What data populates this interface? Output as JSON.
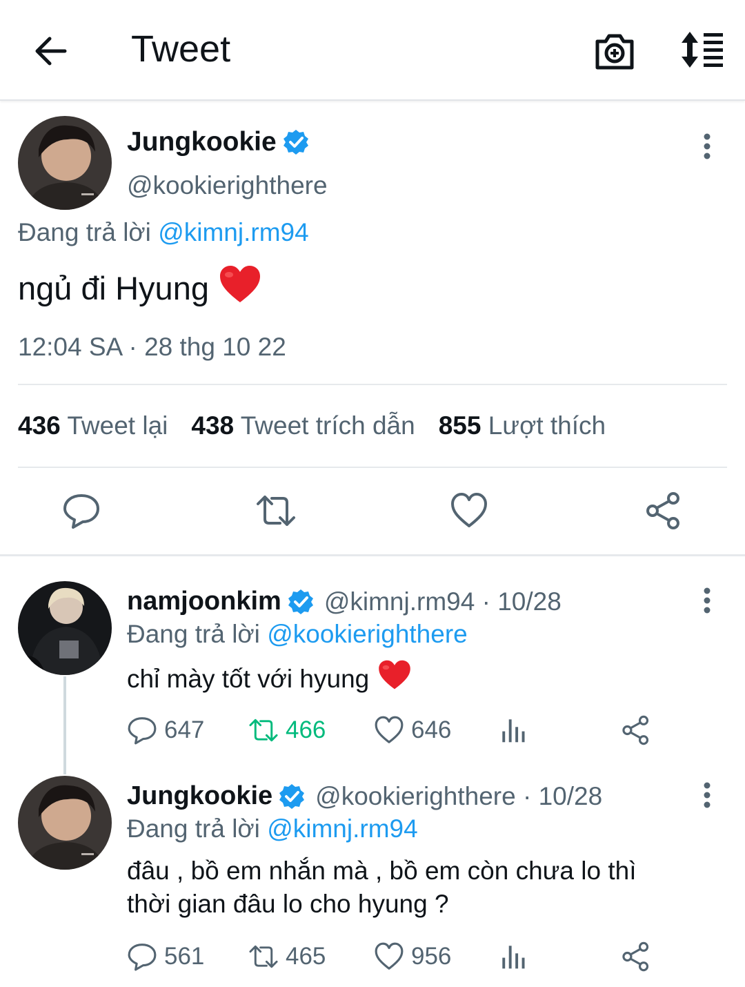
{
  "header": {
    "title": "Tweet"
  },
  "main_tweet": {
    "author_name": "Jungkookie",
    "handle": "@kookierighthere",
    "replying_prefix": "Đang trả lời",
    "replying_to": "@kimnj.rm94",
    "text": "ngủ đi Hyung",
    "emoji": "❤️",
    "timestamp": "12:04 SA · 28 thg 10 22",
    "stats": {
      "retweets": "436",
      "retweets_label": "Tweet lại",
      "quotes": "438",
      "quotes_label": "Tweet trích dẫn",
      "likes": "855",
      "likes_label": "Lượt thích"
    }
  },
  "replies": [
    {
      "author_name": "namjoonkim",
      "handle": "@kimnj.rm94",
      "date": "10/28",
      "replying_prefix": "Đang trả lời",
      "replying_to": "@kookierighthere",
      "text": "chỉ mày tốt với hyung",
      "emoji": "❤️",
      "replies": "647",
      "retweets": "466",
      "likes": "646",
      "retweeted": true
    },
    {
      "author_name": "Jungkookie",
      "handle": "@kookierighthere",
      "date": "10/28",
      "replying_prefix": "Đang trả lời",
      "replying_to": "@kimnj.rm94",
      "text_line1": "đâu , bồ em nhắn mà , bồ em còn chưa lo thì",
      "text_line2": "thời gian đâu lo cho hyung ?",
      "replies": "561",
      "retweets": "465",
      "likes": "956",
      "retweeted": false
    }
  ],
  "colors": {
    "accent": "#1d9bf0",
    "secondary_text": "#536471",
    "retweet_green": "#00ba7c",
    "heart_red": "#e8202a"
  }
}
